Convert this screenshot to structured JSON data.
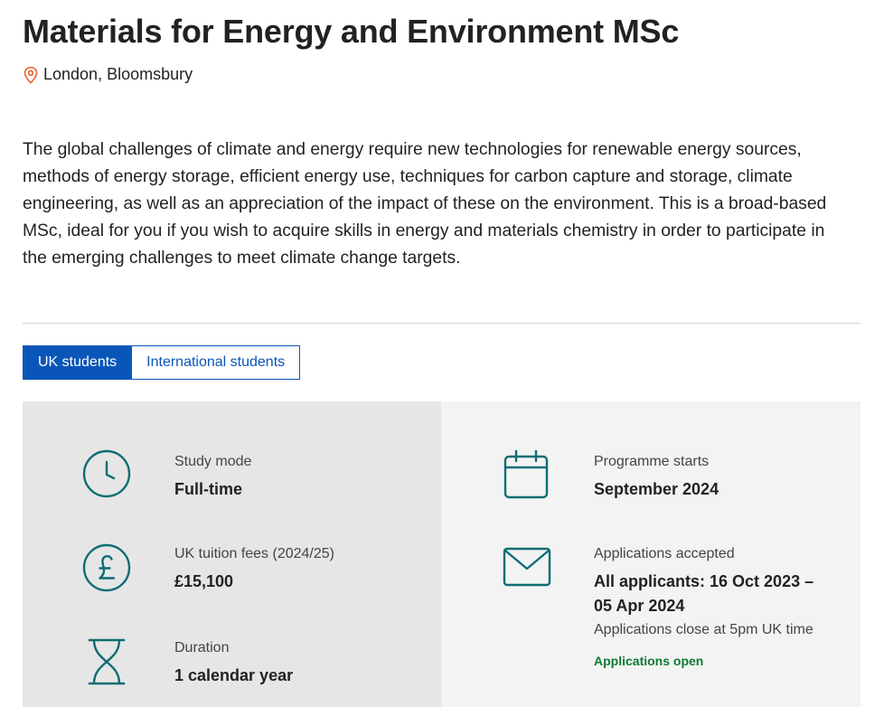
{
  "header": {
    "title": "Materials for Energy and Environment MSc",
    "location_icon": "map-pin-icon",
    "location": "London, Bloomsbury"
  },
  "intro": "The global challenges of climate and energy require new technologies for renewable energy sources, methods of energy storage, efficient energy use, techniques for carbon capture and storage, climate engineering, as well as an appreciation of the impact of these on the environment. This is a broad-based MSc, ideal for you if you wish to acquire skills in energy and materials chemistry in order to participate in the emerging challenges to meet climate change targets.",
  "tabs": [
    {
      "label": "UK students",
      "active": true
    },
    {
      "label": "International students",
      "active": false
    }
  ],
  "details": {
    "study_mode": {
      "icon": "clock-icon",
      "label": "Study mode",
      "value": "Full-time"
    },
    "fees": {
      "icon": "pound-coin-icon",
      "label": "UK tuition fees (2024/25)",
      "value": "£15,100"
    },
    "duration": {
      "icon": "hourglass-icon",
      "label": "Duration",
      "value": "1 calendar year"
    },
    "programme_starts": {
      "icon": "calendar-icon",
      "label": "Programme starts",
      "value": "September 2024"
    },
    "applications": {
      "icon": "envelope-icon",
      "label": "Applications accepted",
      "value_line1": "All applicants: 16 Oct 2023 –",
      "value_line2": "05 Apr 2024",
      "note": "Applications close at 5pm UK time",
      "status": "Applications open"
    }
  },
  "colors": {
    "accent_blue": "#0a56b8",
    "icon_teal": "#0e6d73",
    "pin_orange": "#e8612c",
    "status_green": "#0f7a34"
  }
}
